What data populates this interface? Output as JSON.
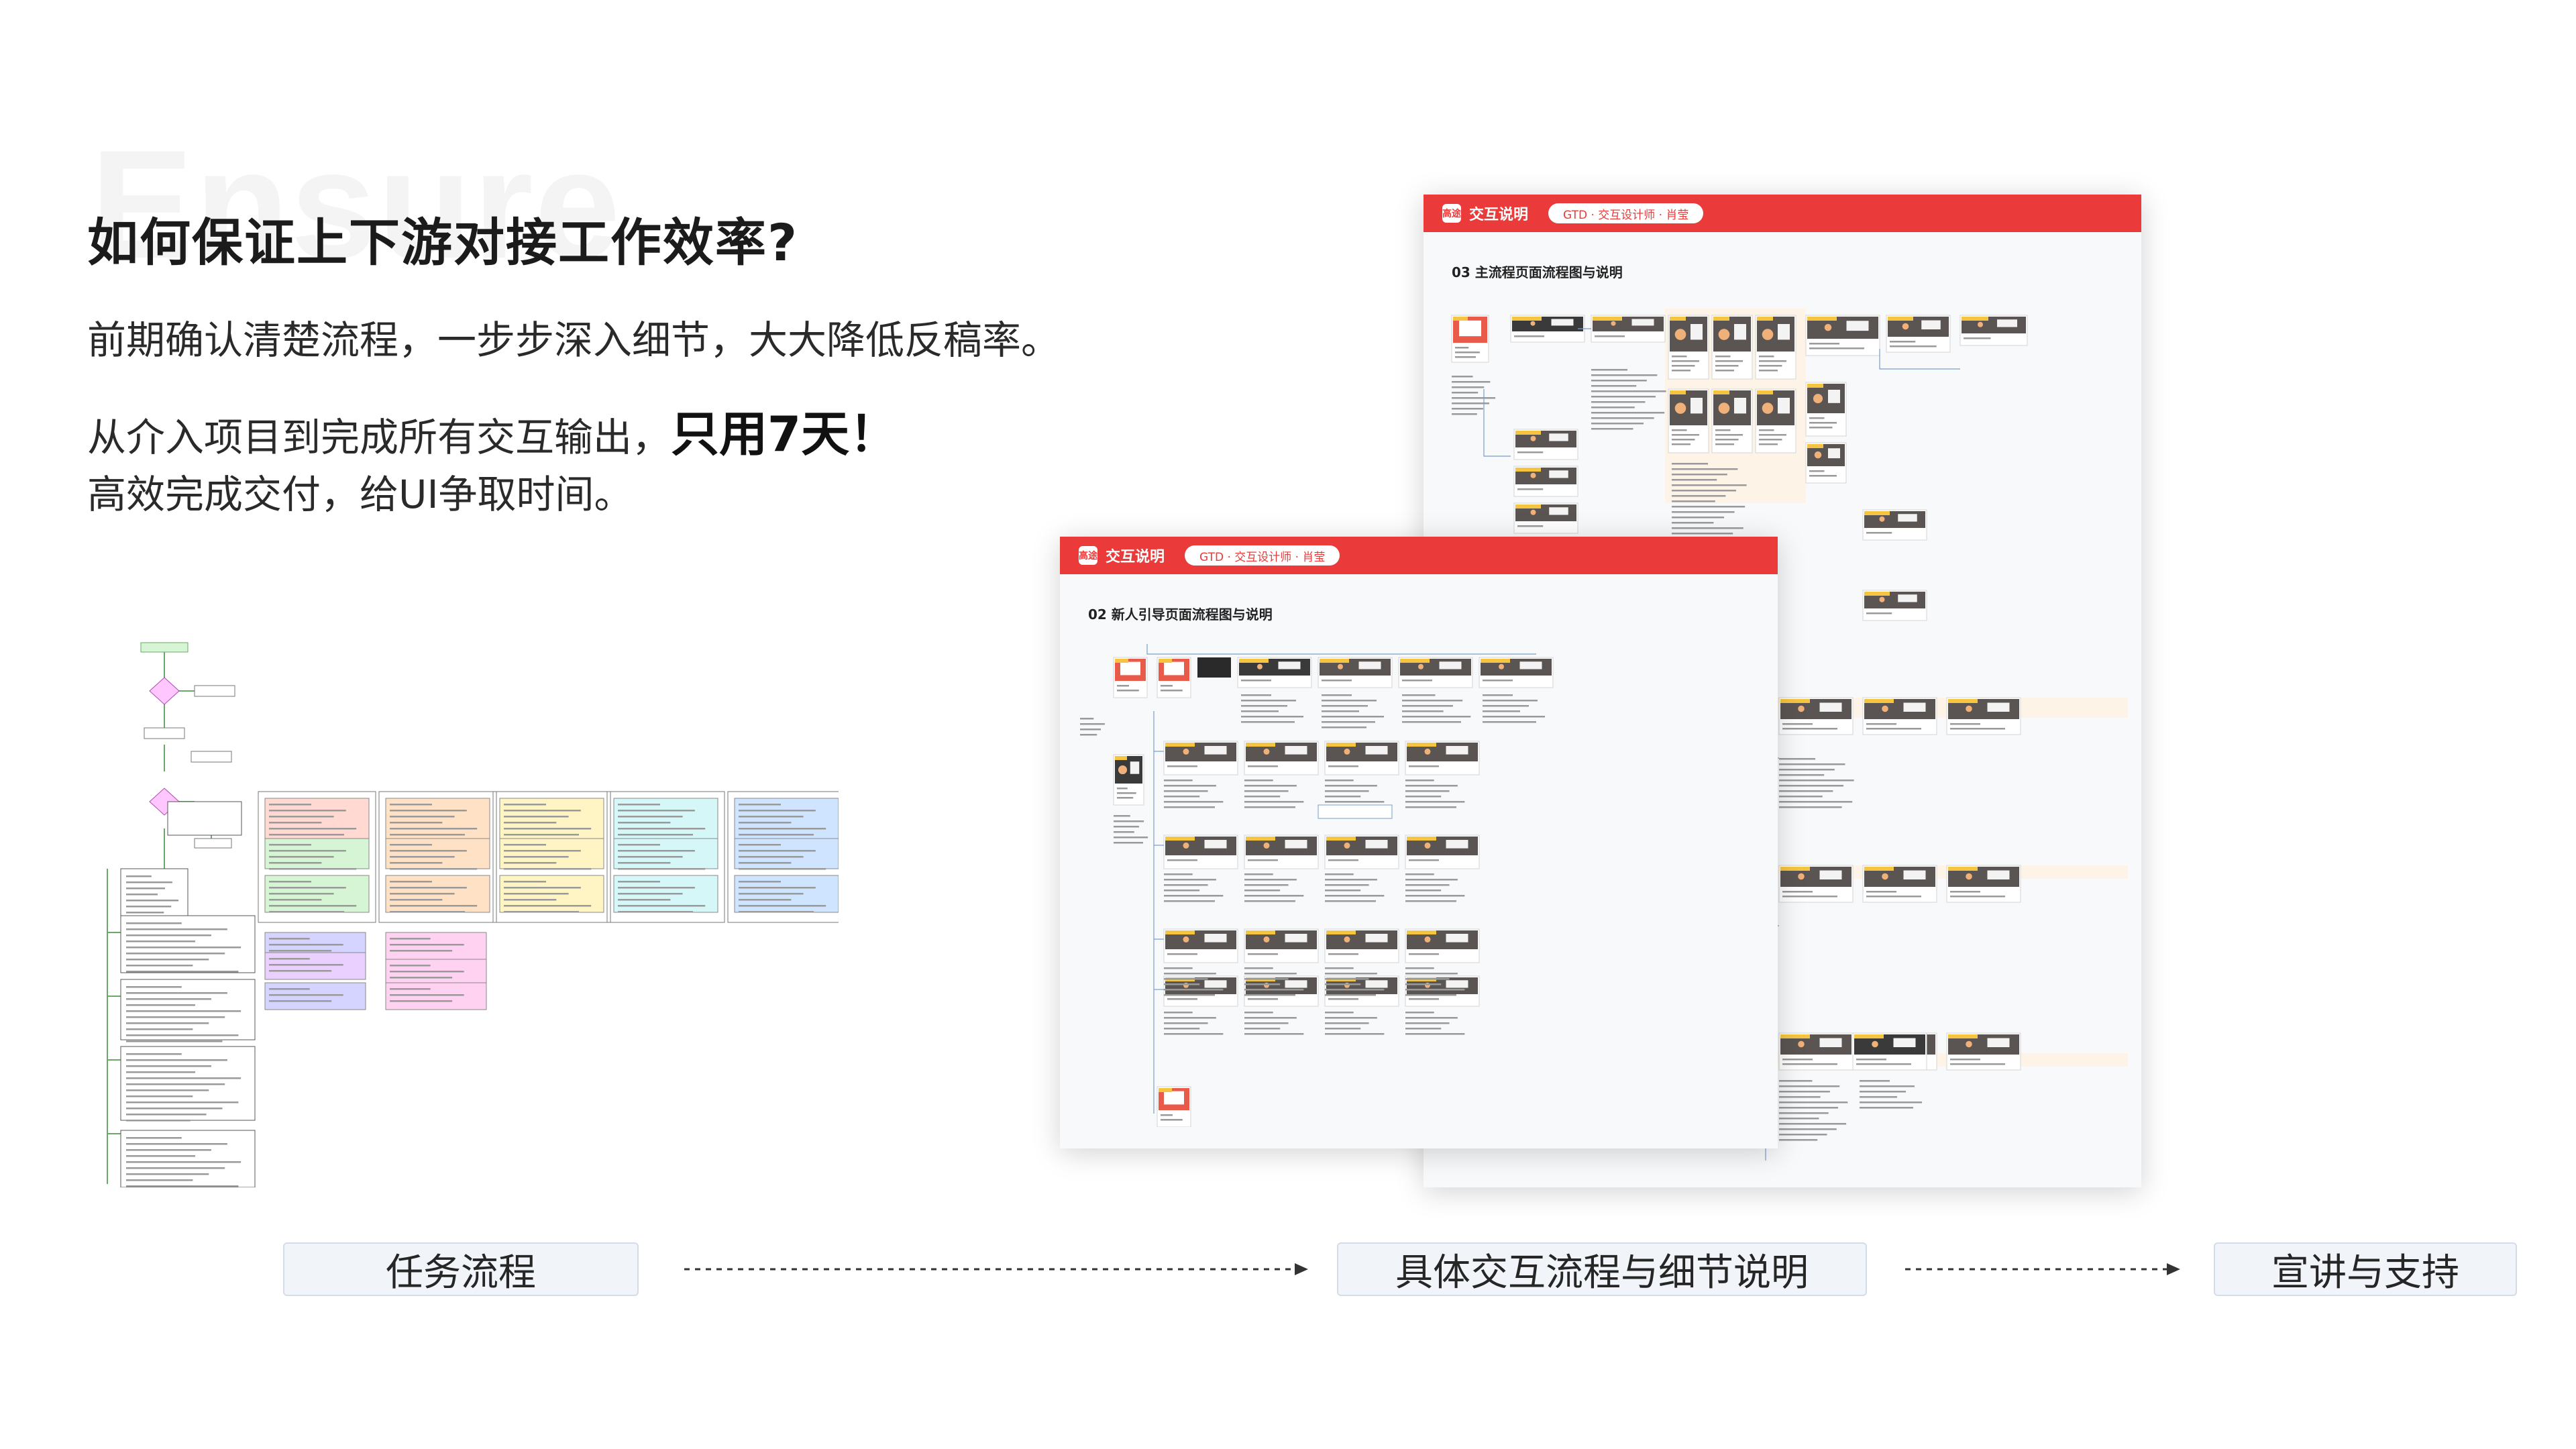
{
  "watermark": "Ensure",
  "title": "如何保证上下游对接工作效率?",
  "paragraph1": "前期确认清楚流程，一步步深入细节，大大降低反稿率。",
  "paragraph2": {
    "prefix": "从介入项目到完成所有交互输出，",
    "emphasis": "只用7天！"
  },
  "paragraph3": "高效完成交付，给UI争取时间。",
  "docs": {
    "back": {
      "logo": "高途",
      "brand": "交互说明",
      "pill": "GTD · 交互设计师 · 肖莹",
      "section": "03 主流程页面流程图与说明"
    },
    "front": {
      "logo": "高途",
      "brand": "交互说明",
      "pill": "GTD · 交互设计师 · 肖莹",
      "section": "02 新人引导页面流程图与说明"
    }
  },
  "flow_colors": [
    "#ffd9d2",
    "#d6f5d4",
    "#ffe2c6",
    "#fff5c4",
    "#d6f7f7",
    "#cfe4ff",
    "#e9d0ff",
    "#d5d3ff",
    "#ffd2f1",
    "#ffc6c6"
  ],
  "steps": [
    {
      "label": "任务流程"
    },
    {
      "label": "具体交互流程与细节说明"
    },
    {
      "label": "宣讲与支持"
    }
  ],
  "colors": {
    "accent_red": "#ea3a3a",
    "step_bg": "#f1f5f9",
    "step_border": "#d3dde8"
  }
}
